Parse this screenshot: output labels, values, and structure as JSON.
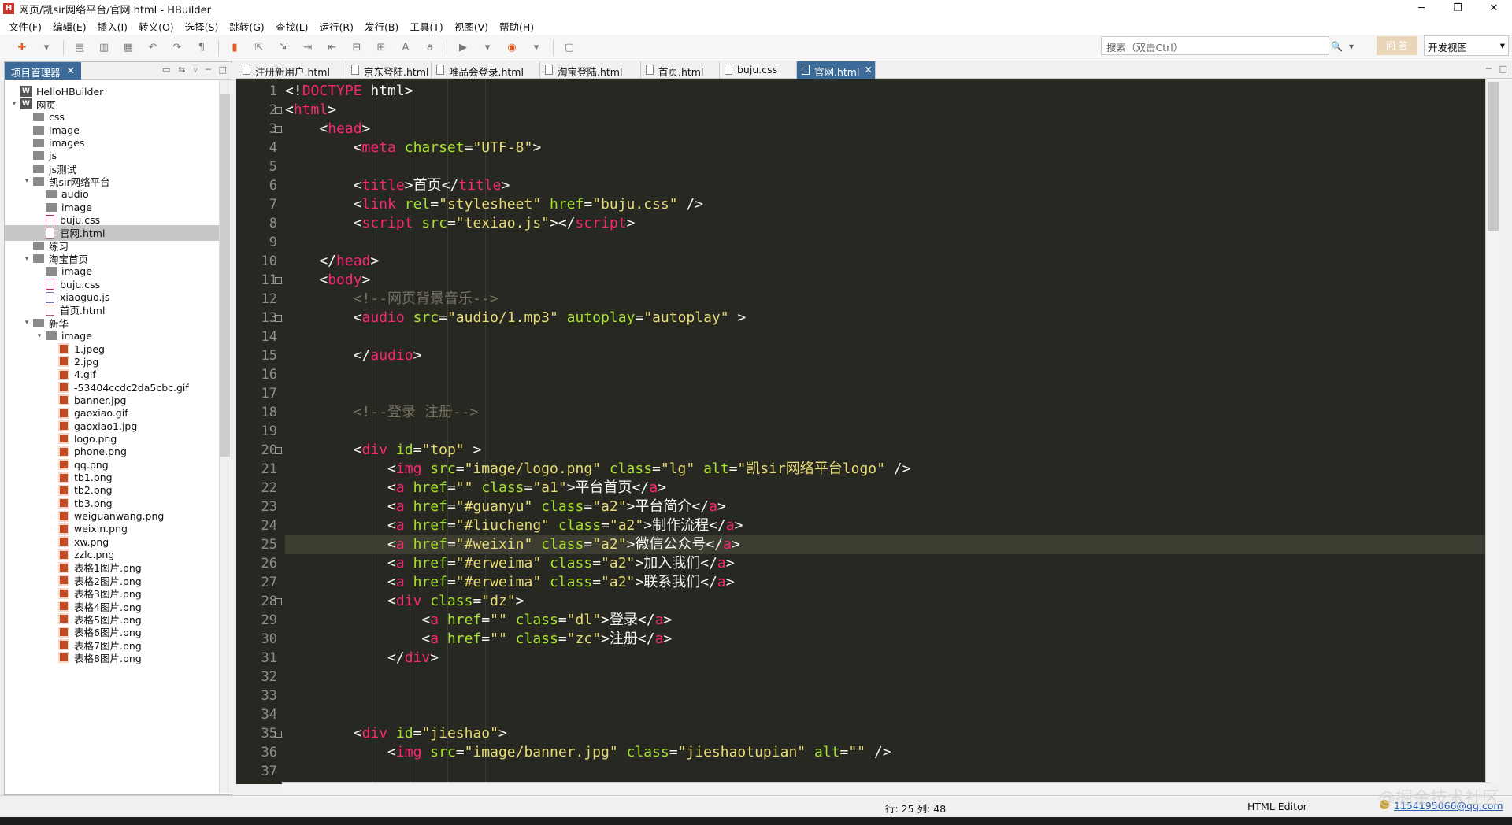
{
  "window": {
    "title": "网页/凯sir网络平台/官网.html  -  HBuilder",
    "icon": "H",
    "controls": [
      "─",
      "❐",
      "✕"
    ]
  },
  "menu": [
    "文件(F)",
    "编辑(E)",
    "插入(I)",
    "转义(O)",
    "选择(S)",
    "跳转(G)",
    "查找(L)",
    "运行(R)",
    "发行(B)",
    "工具(T)",
    "视图(V)",
    "帮助(H)"
  ],
  "search": {
    "placeholder": "搜索（双击Ctrl）"
  },
  "search_icons": {
    "magnify": "🔍",
    "dropdown": "▾"
  },
  "project_button": "问 答",
  "view_select": {
    "value": "开发视图",
    "arrow": "▾"
  },
  "left_panel": {
    "tab": "项目管理器",
    "close": "✕",
    "icons": [
      "▭",
      "⇆",
      "▿",
      "─",
      "□"
    ],
    "tree": [
      {
        "label": "HelloHBuilder",
        "depth": 0,
        "type": "project",
        "arrow": ""
      },
      {
        "label": "网页",
        "depth": 0,
        "type": "project",
        "arrow": "▾"
      },
      {
        "label": "css",
        "depth": 1,
        "type": "folder",
        "arrow": ""
      },
      {
        "label": "image",
        "depth": 1,
        "type": "folder",
        "arrow": ""
      },
      {
        "label": "images",
        "depth": 1,
        "type": "folder",
        "arrow": ""
      },
      {
        "label": "js",
        "depth": 1,
        "type": "folder",
        "arrow": ""
      },
      {
        "label": "js测试",
        "depth": 1,
        "type": "folder",
        "arrow": ""
      },
      {
        "label": "凯sir网络平台",
        "depth": 1,
        "type": "folder",
        "arrow": "▾"
      },
      {
        "label": "audio",
        "depth": 2,
        "type": "folder",
        "arrow": ""
      },
      {
        "label": "image",
        "depth": 2,
        "type": "folder",
        "arrow": ""
      },
      {
        "label": "buju.css",
        "depth": 2,
        "type": "css",
        "arrow": ""
      },
      {
        "label": "官网.html",
        "depth": 2,
        "type": "html",
        "arrow": "",
        "selected": true
      },
      {
        "label": "练习",
        "depth": 1,
        "type": "folder",
        "arrow": ""
      },
      {
        "label": "淘宝首页",
        "depth": 1,
        "type": "folder",
        "arrow": "▾"
      },
      {
        "label": "image",
        "depth": 2,
        "type": "folder",
        "arrow": ""
      },
      {
        "label": "buju.css",
        "depth": 2,
        "type": "css",
        "arrow": ""
      },
      {
        "label": "xiaoguo.js",
        "depth": 2,
        "type": "js",
        "arrow": ""
      },
      {
        "label": "首页.html",
        "depth": 2,
        "type": "html",
        "arrow": ""
      },
      {
        "label": "新华",
        "depth": 1,
        "type": "folder",
        "arrow": "▾"
      },
      {
        "label": "image",
        "depth": 2,
        "type": "folder",
        "arrow": "▾"
      },
      {
        "label": "1.jpeg",
        "depth": 3,
        "type": "img",
        "arrow": ""
      },
      {
        "label": "2.jpg",
        "depth": 3,
        "type": "img",
        "arrow": ""
      },
      {
        "label": "4.gif",
        "depth": 3,
        "type": "img",
        "arrow": ""
      },
      {
        "label": "-53404ccdc2da5cbc.gif",
        "depth": 3,
        "type": "img",
        "arrow": ""
      },
      {
        "label": "banner.jpg",
        "depth": 3,
        "type": "img",
        "arrow": ""
      },
      {
        "label": "gaoxiao.gif",
        "depth": 3,
        "type": "img",
        "arrow": ""
      },
      {
        "label": "gaoxiao1.jpg",
        "depth": 3,
        "type": "img",
        "arrow": ""
      },
      {
        "label": "logo.png",
        "depth": 3,
        "type": "img",
        "arrow": ""
      },
      {
        "label": "phone.png",
        "depth": 3,
        "type": "img",
        "arrow": ""
      },
      {
        "label": "qq.png",
        "depth": 3,
        "type": "img",
        "arrow": ""
      },
      {
        "label": "tb1.png",
        "depth": 3,
        "type": "img",
        "arrow": ""
      },
      {
        "label": "tb2.png",
        "depth": 3,
        "type": "img",
        "arrow": ""
      },
      {
        "label": "tb3.png",
        "depth": 3,
        "type": "img",
        "arrow": ""
      },
      {
        "label": "weiguanwang.png",
        "depth": 3,
        "type": "img",
        "arrow": ""
      },
      {
        "label": "weixin.png",
        "depth": 3,
        "type": "img",
        "arrow": ""
      },
      {
        "label": "xw.png",
        "depth": 3,
        "type": "img",
        "arrow": ""
      },
      {
        "label": "zzlc.png",
        "depth": 3,
        "type": "img",
        "arrow": ""
      },
      {
        "label": "表格1图片.png",
        "depth": 3,
        "type": "img",
        "arrow": ""
      },
      {
        "label": "表格2图片.png",
        "depth": 3,
        "type": "img",
        "arrow": ""
      },
      {
        "label": "表格3图片.png",
        "depth": 3,
        "type": "img",
        "arrow": ""
      },
      {
        "label": "表格4图片.png",
        "depth": 3,
        "type": "img",
        "arrow": ""
      },
      {
        "label": "表格5图片.png",
        "depth": 3,
        "type": "img",
        "arrow": ""
      },
      {
        "label": "表格6图片.png",
        "depth": 3,
        "type": "img",
        "arrow": ""
      },
      {
        "label": "表格7图片.png",
        "depth": 3,
        "type": "img",
        "arrow": ""
      },
      {
        "label": "表格8图片.png",
        "depth": 3,
        "type": "img",
        "arrow": ""
      }
    ]
  },
  "tabs": [
    {
      "label": "注册新用户.html"
    },
    {
      "label": "京东登陆.html"
    },
    {
      "label": "唯品会登录.html"
    },
    {
      "label": "淘宝登陆.html"
    },
    {
      "label": "首页.html"
    },
    {
      "label": "buju.css"
    },
    {
      "label": "官网.html",
      "active": true,
      "close": "✕"
    }
  ],
  "tab_icons": [
    "─",
    "□"
  ],
  "editor": {
    "current_line": 25,
    "fold_lines": [
      2,
      3,
      11,
      13,
      20,
      28,
      35
    ],
    "lines": [
      [
        [
          "p",
          "<!"
        ],
        [
          "t",
          "DOCTYPE"
        ],
        [
          "p",
          " html>"
        ]
      ],
      [
        [
          "p",
          "<"
        ],
        [
          "t",
          "html"
        ],
        [
          "p",
          ">"
        ]
      ],
      [
        [
          "p",
          "    <"
        ],
        [
          "t",
          "head"
        ],
        [
          "p",
          ">"
        ]
      ],
      [
        [
          "p",
          "        <"
        ],
        [
          "t",
          "meta"
        ],
        [
          "p",
          " "
        ],
        [
          "a",
          "charset"
        ],
        [
          "p",
          "="
        ],
        [
          "s",
          "\"UTF-8\""
        ],
        [
          "p",
          ">"
        ]
      ],
      [],
      [
        [
          "p",
          "        <"
        ],
        [
          "t",
          "title"
        ],
        [
          "p",
          ">首页</"
        ],
        [
          "t",
          "title"
        ],
        [
          "p",
          ">"
        ]
      ],
      [
        [
          "p",
          "        <"
        ],
        [
          "t",
          "link"
        ],
        [
          "p",
          " "
        ],
        [
          "a",
          "rel"
        ],
        [
          "p",
          "="
        ],
        [
          "s",
          "\"stylesheet\""
        ],
        [
          "p",
          " "
        ],
        [
          "a",
          "href"
        ],
        [
          "p",
          "="
        ],
        [
          "s",
          "\"buju.css\""
        ],
        [
          "p",
          " />"
        ]
      ],
      [
        [
          "p",
          "        <"
        ],
        [
          "t",
          "script"
        ],
        [
          "p",
          " "
        ],
        [
          "a",
          "src"
        ],
        [
          "p",
          "="
        ],
        [
          "s",
          "\"texiao.js\""
        ],
        [
          "p",
          "></"
        ],
        [
          "t",
          "script"
        ],
        [
          "p",
          ">"
        ]
      ],
      [],
      [
        [
          "p",
          "    </"
        ],
        [
          "t",
          "head"
        ],
        [
          "p",
          ">"
        ]
      ],
      [
        [
          "p",
          "    <"
        ],
        [
          "t",
          "body"
        ],
        [
          "p",
          ">"
        ]
      ],
      [
        [
          "c",
          "        <!--网页背景音乐-->"
        ]
      ],
      [
        [
          "p",
          "        <"
        ],
        [
          "t",
          "audio"
        ],
        [
          "p",
          " "
        ],
        [
          "a",
          "src"
        ],
        [
          "p",
          "="
        ],
        [
          "s",
          "\"audio/1.mp3\""
        ],
        [
          "p",
          " "
        ],
        [
          "a",
          "autoplay"
        ],
        [
          "p",
          "="
        ],
        [
          "s",
          "\"autoplay\""
        ],
        [
          "p",
          " >"
        ]
      ],
      [],
      [
        [
          "p",
          "        </"
        ],
        [
          "t",
          "audio"
        ],
        [
          "p",
          ">"
        ]
      ],
      [],
      [],
      [
        [
          "c",
          "        <!--登录 注册-->"
        ]
      ],
      [],
      [
        [
          "p",
          "        <"
        ],
        [
          "t",
          "div"
        ],
        [
          "p",
          " "
        ],
        [
          "a",
          "id"
        ],
        [
          "p",
          "="
        ],
        [
          "s",
          "\"top\""
        ],
        [
          "p",
          " >"
        ]
      ],
      [
        [
          "p",
          "            <"
        ],
        [
          "t",
          "img"
        ],
        [
          "p",
          " "
        ],
        [
          "a",
          "src"
        ],
        [
          "p",
          "="
        ],
        [
          "s",
          "\"image/logo.png\""
        ],
        [
          "p",
          " "
        ],
        [
          "a",
          "class"
        ],
        [
          "p",
          "="
        ],
        [
          "s",
          "\"lg\""
        ],
        [
          "p",
          " "
        ],
        [
          "a",
          "alt"
        ],
        [
          "p",
          "="
        ],
        [
          "s",
          "\"凯sir网络平台logo\""
        ],
        [
          "p",
          " />"
        ]
      ],
      [
        [
          "p",
          "            <"
        ],
        [
          "t",
          "a"
        ],
        [
          "p",
          " "
        ],
        [
          "a",
          "href"
        ],
        [
          "p",
          "="
        ],
        [
          "s",
          "\"\""
        ],
        [
          "p",
          " "
        ],
        [
          "a",
          "class"
        ],
        [
          "p",
          "="
        ],
        [
          "s",
          "\"a1\""
        ],
        [
          "p",
          ">平台首页</"
        ],
        [
          "t",
          "a"
        ],
        [
          "p",
          ">"
        ]
      ],
      [
        [
          "p",
          "            <"
        ],
        [
          "t",
          "a"
        ],
        [
          "p",
          " "
        ],
        [
          "a",
          "href"
        ],
        [
          "p",
          "="
        ],
        [
          "s",
          "\"#guanyu\""
        ],
        [
          "p",
          " "
        ],
        [
          "a",
          "class"
        ],
        [
          "p",
          "="
        ],
        [
          "s",
          "\"a2\""
        ],
        [
          "p",
          ">平台简介</"
        ],
        [
          "t",
          "a"
        ],
        [
          "p",
          ">"
        ]
      ],
      [
        [
          "p",
          "            <"
        ],
        [
          "t",
          "a"
        ],
        [
          "p",
          " "
        ],
        [
          "a",
          "href"
        ],
        [
          "p",
          "="
        ],
        [
          "s",
          "\"#liucheng\""
        ],
        [
          "p",
          " "
        ],
        [
          "a",
          "class"
        ],
        [
          "p",
          "="
        ],
        [
          "s",
          "\"a2\""
        ],
        [
          "p",
          ">制作流程</"
        ],
        [
          "t",
          "a"
        ],
        [
          "p",
          ">"
        ]
      ],
      [
        [
          "p",
          "            <"
        ],
        [
          "t",
          "a"
        ],
        [
          "p",
          " "
        ],
        [
          "a",
          "href"
        ],
        [
          "p",
          "="
        ],
        [
          "s",
          "\"#weixin\""
        ],
        [
          "p",
          " "
        ],
        [
          "a",
          "class"
        ],
        [
          "p",
          "="
        ],
        [
          "s",
          "\"a2\""
        ],
        [
          "p",
          ">微信公众号</"
        ],
        [
          "t",
          "a"
        ],
        [
          "p",
          ">"
        ]
      ],
      [
        [
          "p",
          "            <"
        ],
        [
          "t",
          "a"
        ],
        [
          "p",
          " "
        ],
        [
          "a",
          "href"
        ],
        [
          "p",
          "="
        ],
        [
          "s",
          "\"#erweima\""
        ],
        [
          "p",
          " "
        ],
        [
          "a",
          "class"
        ],
        [
          "p",
          "="
        ],
        [
          "s",
          "\"a2\""
        ],
        [
          "p",
          ">加入我们</"
        ],
        [
          "t",
          "a"
        ],
        [
          "p",
          ">"
        ]
      ],
      [
        [
          "p",
          "            <"
        ],
        [
          "t",
          "a"
        ],
        [
          "p",
          " "
        ],
        [
          "a",
          "href"
        ],
        [
          "p",
          "="
        ],
        [
          "s",
          "\"#erweima\""
        ],
        [
          "p",
          " "
        ],
        [
          "a",
          "class"
        ],
        [
          "p",
          "="
        ],
        [
          "s",
          "\"a2\""
        ],
        [
          "p",
          ">联系我们</"
        ],
        [
          "t",
          "a"
        ],
        [
          "p",
          ">"
        ]
      ],
      [
        [
          "p",
          "            <"
        ],
        [
          "t",
          "div"
        ],
        [
          "p",
          " "
        ],
        [
          "a",
          "class"
        ],
        [
          "p",
          "="
        ],
        [
          "s",
          "\"dz\""
        ],
        [
          "p",
          ">"
        ]
      ],
      [
        [
          "p",
          "                <"
        ],
        [
          "t",
          "a"
        ],
        [
          "p",
          " "
        ],
        [
          "a",
          "href"
        ],
        [
          "p",
          "="
        ],
        [
          "s",
          "\"\""
        ],
        [
          "p",
          " "
        ],
        [
          "a",
          "class"
        ],
        [
          "p",
          "="
        ],
        [
          "s",
          "\"dl\""
        ],
        [
          "p",
          ">登录</"
        ],
        [
          "t",
          "a"
        ],
        [
          "p",
          ">"
        ]
      ],
      [
        [
          "p",
          "                <"
        ],
        [
          "t",
          "a"
        ],
        [
          "p",
          " "
        ],
        [
          "a",
          "href"
        ],
        [
          "p",
          "="
        ],
        [
          "s",
          "\"\""
        ],
        [
          "p",
          " "
        ],
        [
          "a",
          "class"
        ],
        [
          "p",
          "="
        ],
        [
          "s",
          "\"zc\""
        ],
        [
          "p",
          ">注册</"
        ],
        [
          "t",
          "a"
        ],
        [
          "p",
          ">"
        ]
      ],
      [
        [
          "p",
          "            </"
        ],
        [
          "t",
          "div"
        ],
        [
          "p",
          ">"
        ]
      ],
      [],
      [],
      [],
      [
        [
          "p",
          "        <"
        ],
        [
          "t",
          "div"
        ],
        [
          "p",
          " "
        ],
        [
          "a",
          "id"
        ],
        [
          "p",
          "="
        ],
        [
          "s",
          "\"jieshao\""
        ],
        [
          "p",
          ">"
        ]
      ],
      [
        [
          "p",
          "            <"
        ],
        [
          "t",
          "img"
        ],
        [
          "p",
          " "
        ],
        [
          "a",
          "src"
        ],
        [
          "p",
          "="
        ],
        [
          "s",
          "\"image/banner.jpg\""
        ],
        [
          "p",
          " "
        ],
        [
          "a",
          "class"
        ],
        [
          "p",
          "="
        ],
        [
          "s",
          "\"jieshaotupian\""
        ],
        [
          "p",
          " "
        ],
        [
          "a",
          "alt"
        ],
        [
          "p",
          "="
        ],
        [
          "s",
          "\"\""
        ],
        [
          "p",
          " />"
        ]
      ],
      []
    ]
  },
  "status": {
    "position": "行: 25 列: 48",
    "mode": "HTML Editor",
    "user": "1154195066@qq.com"
  },
  "watermark": "@掘金技术社区",
  "colors": {
    "tag": "#f92672",
    "attr": "#a6e22e",
    "string": "#e6db74",
    "comment": "#75715e",
    "bg": "#272822",
    "accent": "#3d6b99"
  }
}
